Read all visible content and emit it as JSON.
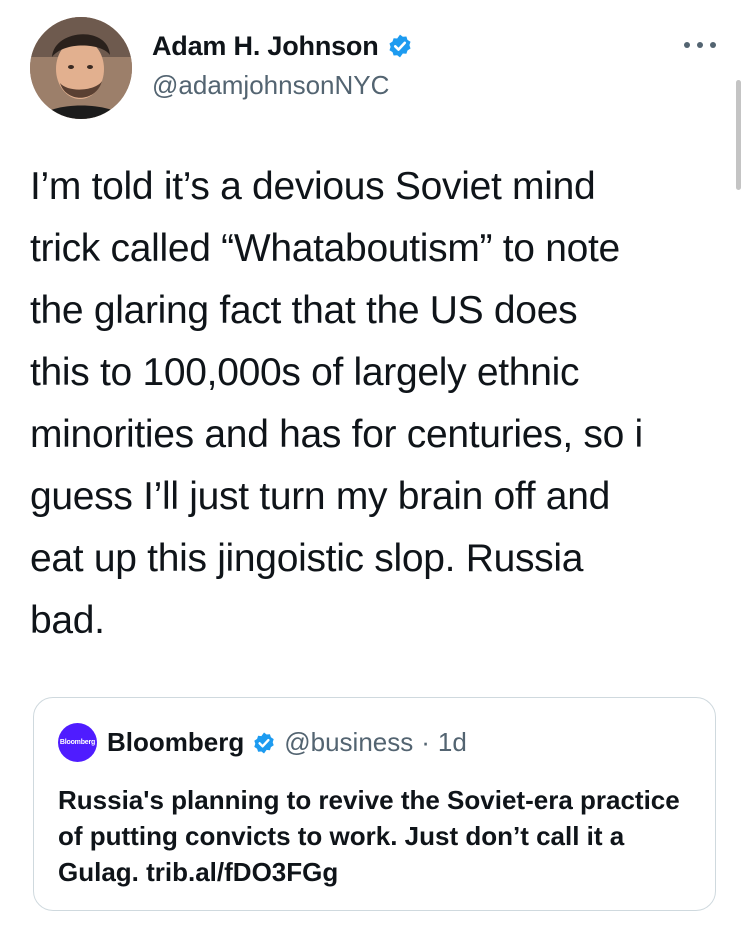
{
  "tweet": {
    "author": {
      "display_name": "Adam H. Johnson",
      "handle": "@adamjohnsonNYC",
      "verified": true
    },
    "text": "I’m told it’s a devious Soviet mind\ntrick called “Whataboutism” to note\nthe glaring fact that the US does\nthis to 100,000s of largely ethnic\nminorities and has for centuries, so i\nguess I’ll just turn my brain off and\neat up this jingoistic slop. Russia\nbad."
  },
  "quoted_tweet": {
    "avatar_label": "Bloomberg",
    "display_name": "Bloomberg",
    "verified": true,
    "handle": "@business",
    "separator": "·",
    "time": "1d",
    "text": "Russia's planning to revive the Soviet-era practice of putting convicts to work. Just don’t call it a Gulag. trib.al/fDO3FGg"
  },
  "icons": {
    "more": "more-horizontal-icon",
    "verified": "verified-badge-icon"
  },
  "colors": {
    "verified_blue": "#1d9bf0",
    "bloomberg_purple": "#4f1cff",
    "secondary_text": "#536471"
  }
}
